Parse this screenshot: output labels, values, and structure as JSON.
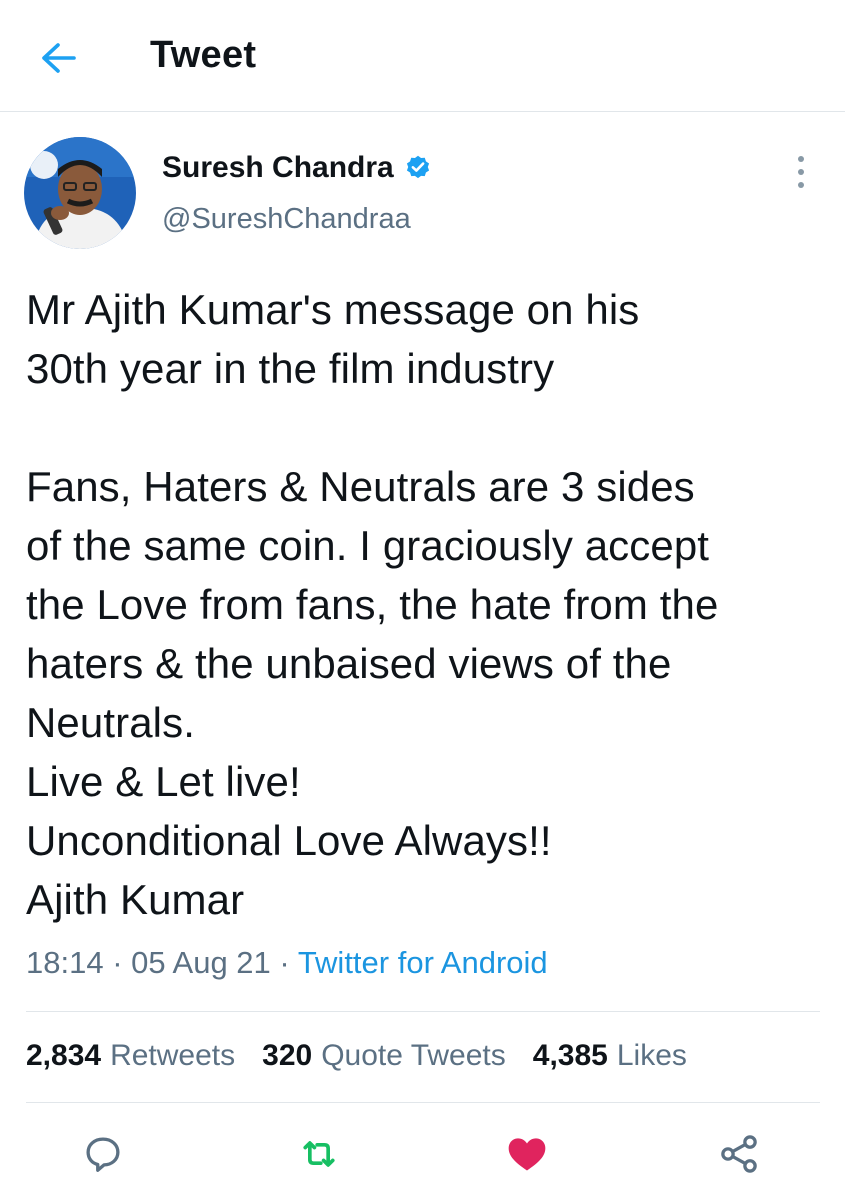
{
  "header": {
    "title": "Tweet",
    "back_icon": "arrow-left-icon"
  },
  "author": {
    "name": "Suresh Chandra",
    "handle": "@SureshChandraa",
    "verified_icon": "verified-badge-icon"
  },
  "tweet": {
    "text": "Mr Ajith Kumar's  message on his\n30th year in the film industry\n\nFans, Haters & Neutrals are 3 sides\nof the same coin. I graciously accept\nthe Love from fans, the hate from the\nhaters & the unbaised views of the\nNeutrals.\nLive & Let live!\nUnconditional Love Always!!\nAjith Kumar",
    "time": "18:14",
    "date": "05 Aug 21",
    "separator": "·",
    "source": "Twitter for Android"
  },
  "stats": {
    "retweets_count": "2,834",
    "retweets_label": "Retweets",
    "quotes_count": "320",
    "quotes_label": "Quote Tweets",
    "likes_count": "4,385",
    "likes_label": "Likes"
  },
  "actions": {
    "reply_icon": "reply-icon",
    "retweet_icon": "retweet-icon",
    "like_icon": "heart-icon",
    "share_icon": "share-icon"
  },
  "colors": {
    "accent": "#1da1f2",
    "retweet": "#17bf63",
    "like": "#e0245e",
    "secondary_text": "#5b7083"
  }
}
